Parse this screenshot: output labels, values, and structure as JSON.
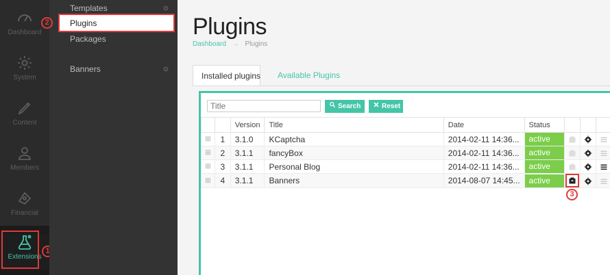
{
  "rail": {
    "items": [
      {
        "label": "Dashboard",
        "icon": "gauge-icon"
      },
      {
        "label": "System",
        "icon": "gear-icon"
      },
      {
        "label": "Content",
        "icon": "pencil-icon"
      },
      {
        "label": "Members",
        "icon": "user-icon"
      },
      {
        "label": "Financial",
        "icon": "money-icon"
      },
      {
        "label": "Extensions",
        "icon": "flask-icon"
      }
    ],
    "active_color": "#45c5a8"
  },
  "subnav": {
    "items": [
      {
        "label": "Templates"
      },
      {
        "label": "Plugins"
      },
      {
        "label": "Packages"
      },
      {
        "label": "Banners"
      }
    ]
  },
  "page": {
    "title": "Plugins",
    "breadcrumb": {
      "home": "Dashboard",
      "separator": "→",
      "current": "Plugins"
    }
  },
  "tabs": [
    "Installed plugins",
    "Available Plugins"
  ],
  "filter": {
    "placeholder": "Title",
    "search_label": "Search",
    "reset_label": "Reset"
  },
  "table": {
    "headers": [
      "",
      "",
      "Version",
      "Title",
      "Date",
      "Status",
      "",
      "",
      ""
    ],
    "rows": [
      {
        "expand": "⊞",
        "num": "1",
        "version": "3.1.0",
        "title": "KCaptcha",
        "date": "2014-02-11 14:36...",
        "status": "active"
      },
      {
        "expand": "⊞",
        "num": "2",
        "version": "3.1.1",
        "title": "fancyBox",
        "date": "2014-02-11 14:36...",
        "status": "active"
      },
      {
        "expand": "⊞",
        "num": "3",
        "version": "3.1.1",
        "title": "Personal Blog",
        "date": "2014-02-11 14:36...",
        "status": "active"
      },
      {
        "expand": "⊞",
        "num": "4",
        "version": "3.1.1",
        "title": "Banners",
        "date": "2014-08-07 14:45...",
        "status": "active"
      }
    ]
  },
  "callouts": [
    "1",
    "2",
    "3"
  ],
  "colors": {
    "accent": "#45c5a8",
    "status_active": "#7bcd4a",
    "highlight": "#e03a3a"
  }
}
